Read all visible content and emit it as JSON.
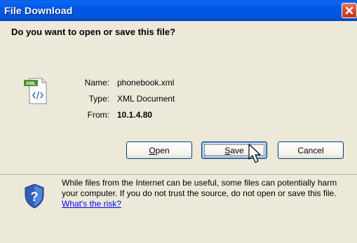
{
  "window": {
    "title": "File Download"
  },
  "dialog": {
    "question": "Do you want to open or save this file?",
    "file": {
      "name_label": "Name:",
      "name_value": "phonebook.xml",
      "type_label": "Type:",
      "type_value": "XML Document",
      "from_label": "From:",
      "from_value": "10.1.4.80",
      "icon": "xml-file-icon",
      "icon_badge": "XML"
    },
    "buttons": {
      "open_label": "Open",
      "save_label": "Save",
      "cancel_label": "Cancel"
    },
    "warning": {
      "icon": "security-shield-question-icon",
      "text": "While files from the Internet can be useful, some files can potentially harm your computer. If you do not trust the source, do not open or save this file.",
      "link": "What's the risk?"
    }
  },
  "colors": {
    "titlebar": "#0054e3",
    "close_button": "#d8492b",
    "dialog_background": "#ece9d8",
    "link": "#0000ff",
    "button_border": "#003c74"
  }
}
